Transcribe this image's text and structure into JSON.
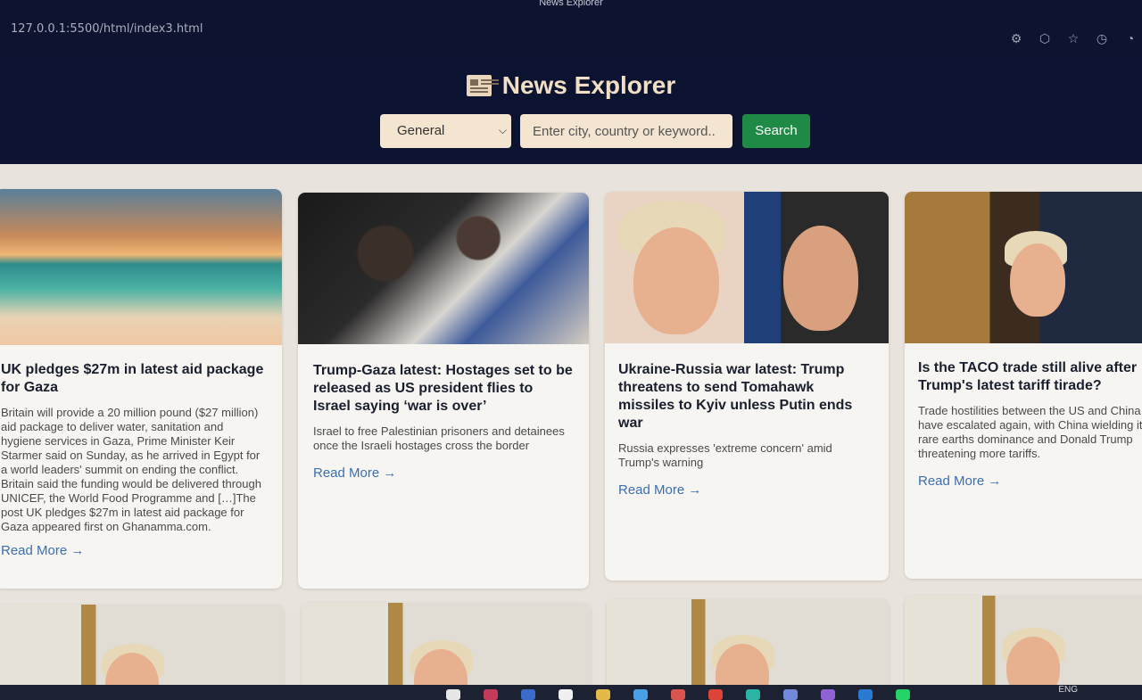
{
  "browser": {
    "window_title": "News Explorer",
    "url": "127.0.0.1:5500/html/index3.html"
  },
  "header": {
    "title": "News Explorer",
    "icon": "newspaper-icon"
  },
  "search": {
    "category_selected": "General",
    "placeholder": "Enter city, country or keyword..",
    "button_label": "Search"
  },
  "articles": [
    {
      "title": "UK pledges $27m in latest aid package for Gaza",
      "description": "Britain will provide a 20 million pound ($27 million) aid package to deliver water, sanitation and hygiene services in Gaza, Prime Minister Keir Starmer said on Sunday, as he arrived in Egypt for a world leaders' summit on ending the conflict. Britain said the funding would be delivered through UNICEF, the World Food Programme and […]The post UK pledges $27m in latest aid package for Gaza appeared first on Ghanamma.com.",
      "link_label": "Read More →"
    },
    {
      "title": "Trump-Gaza latest: Hostages set to be released as US president flies to Israel saying ‘war is over’",
      "description": "Israel to free Palestinian prisoners and detainees once the Israeli hostages cross the border",
      "link_label": "Read More →"
    },
    {
      "title": "Ukraine-Russia war latest: Trump threatens to send Tomahawk missiles to Kyiv unless Putin ends war",
      "description": "Russia expresses 'extreme concern' amid Trump's warning",
      "link_label": "Read More →"
    },
    {
      "title": "Is the TACO trade still alive after Trump's latest tariff tirade?",
      "description": "Trade hostilities between the US and China have escalated again, with China wielding its rare earths dominance and Donald Trump threatening more tariffs.",
      "link_label": "Read More →"
    }
  ],
  "taskbar": {
    "language": "ENG"
  }
}
